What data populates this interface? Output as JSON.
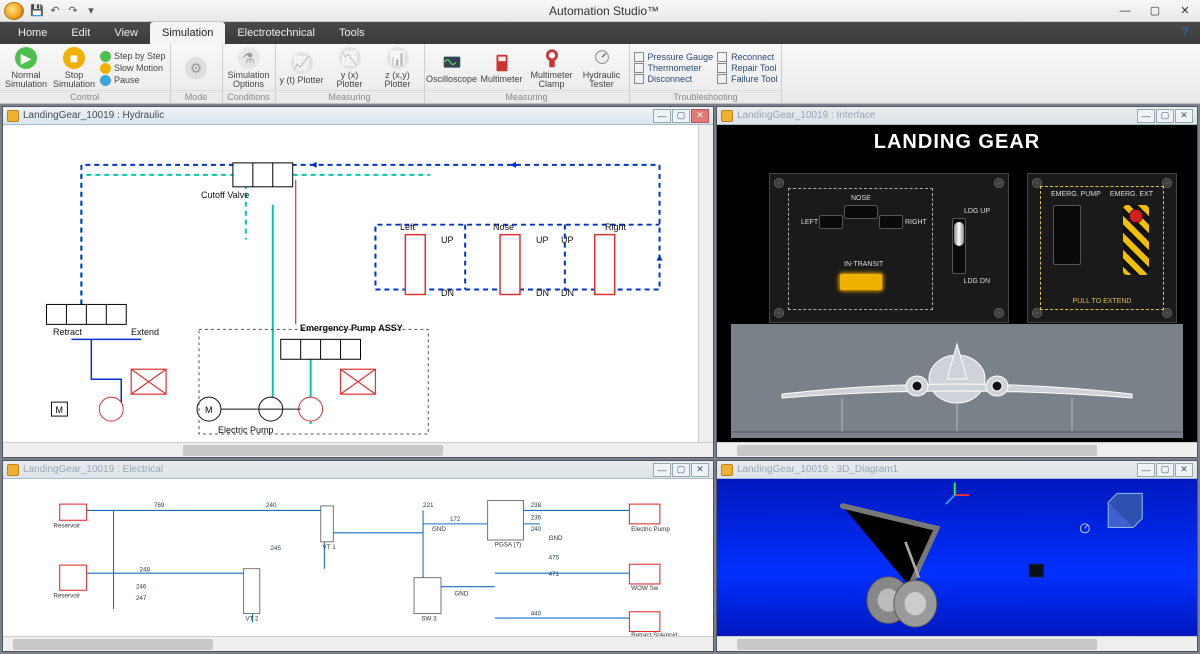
{
  "app": {
    "title": "Automation Studio™"
  },
  "tabs": [
    "Home",
    "Edit",
    "View",
    "Simulation",
    "Electrotechnical",
    "Tools"
  ],
  "active_tab": "Simulation",
  "ribbon": {
    "groups": {
      "control": {
        "label": "Control",
        "normal": "Normal Simulation",
        "stop": "Stop Simulation",
        "step": "Step by Step",
        "slow": "Slow Motion",
        "pause": "Pause"
      },
      "mode": {
        "label": "Mode"
      },
      "conditions": {
        "label": "Conditions",
        "opts": "Simulation Options"
      },
      "measuring": {
        "label": "Measuring",
        "yt": "y (t) Plotter",
        "yx": "y (x) Plotter",
        "zxy": "z (x,y) Plotter",
        "osc": "Oscilloscope",
        "mm": "Multimeter",
        "mc": "Multimeter Clamp",
        "ht": "Hydraulic Tester"
      },
      "trouble": {
        "label": "Troubleshooting",
        "pg": "Pressure Gauge",
        "th": "Thermometer",
        "dc": "Disconnect",
        "rc": "Reconnect",
        "rt": "Repair Tool",
        "ft": "Failure Tool"
      }
    }
  },
  "panes": {
    "hydraulic": {
      "title": "LandingGear_10019 : Hydraulic",
      "labels": {
        "cutoff": "Cutoff Valve",
        "left": "Left",
        "nose": "Nose",
        "right": "Right",
        "up": "UP",
        "dn": "DN",
        "retract": "Retract",
        "extend": "Extend",
        "epump": "Electric Pump",
        "assy": "Emergency Pump ASSY"
      }
    },
    "interface": {
      "title": "LandingGear_10019 : Interface",
      "heading": "LANDING GEAR",
      "labels": {
        "nose": "NOSE",
        "left": "LEFT",
        "right": "RIGHT",
        "intransit": "IN-TRANSIT",
        "ldgup": "LDG UP",
        "ldgdn": "LDG DN",
        "epump": "EMERG. PUMP",
        "eext": "EMERG. EXT",
        "pull": "PULL TO EXTEND"
      }
    },
    "electrical": {
      "title": "LandingGear_10019 : Electrical",
      "wires": [
        "769",
        "240",
        "221",
        "238",
        "236",
        "240",
        "248",
        "172",
        "246",
        "247",
        "245",
        "475",
        "471",
        "440"
      ],
      "labels": {
        "vt1": "VT 1",
        "vt2": "VT 2",
        "sw3": "SW 3",
        "gnd": "GND",
        "pgsa": "PGSA (7)",
        "ep": "Electric Pump",
        "rs": "Retract Solenoid",
        "wow": "WOW Sw",
        "res": "Reservoir"
      }
    },
    "v3d": {
      "title": "LandingGear_10019 : 3D_Diagram1"
    }
  }
}
